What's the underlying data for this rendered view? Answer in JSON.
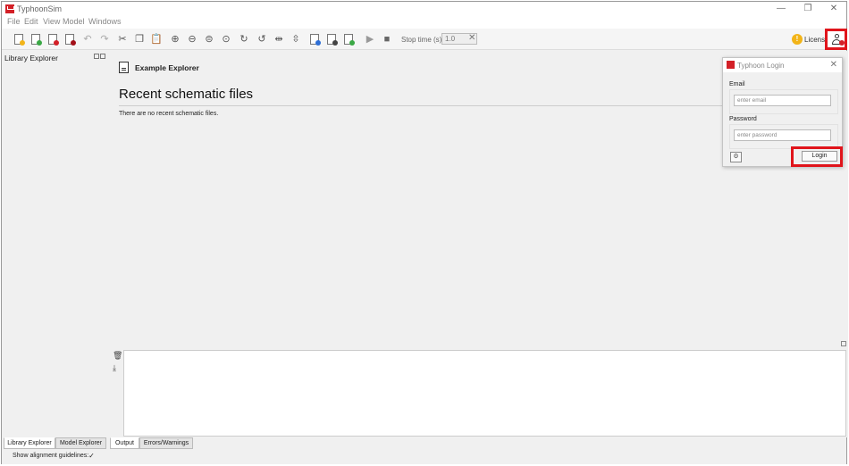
{
  "window": {
    "title": "TyphoonSim",
    "minimize": "—",
    "maximize": "❐",
    "close": "✕"
  },
  "menu": [
    "File",
    "Edit",
    "View",
    "Model",
    "Windows"
  ],
  "toolbar": {
    "stop_time_label": "Stop time (s):",
    "stop_time_value": "1.0",
    "clear": "✕",
    "license_badge": "!",
    "license_label": "License"
  },
  "left_panel": {
    "title": "Library Explorer"
  },
  "main": {
    "explorer_title": "Example Explorer",
    "recent_title": "Recent schematic files",
    "recent_empty": "There are no recent schematic files."
  },
  "login_dialog": {
    "title": "Typhoon Login",
    "close": "✕",
    "email_label": "Email",
    "email_placeholder": "enter email",
    "password_label": "Password",
    "password_placeholder": "enter password",
    "login_button": "Login",
    "settings_icon": "⚙"
  },
  "output_panel": {
    "clear_icon": "🗑",
    "download_icon": "⤓"
  },
  "left_tabs": [
    "Library Explorer",
    "Model Explorer"
  ],
  "bottom_tabs": [
    "Output",
    "Errors/Warnings"
  ],
  "status": {
    "guidelines_label": "Show alignment guidelines:",
    "guidelines_checked": "✓"
  },
  "colors": {
    "brand_red": "#d32027",
    "highlight_red": "#e0141b",
    "license_yellow": "#f2b418"
  }
}
